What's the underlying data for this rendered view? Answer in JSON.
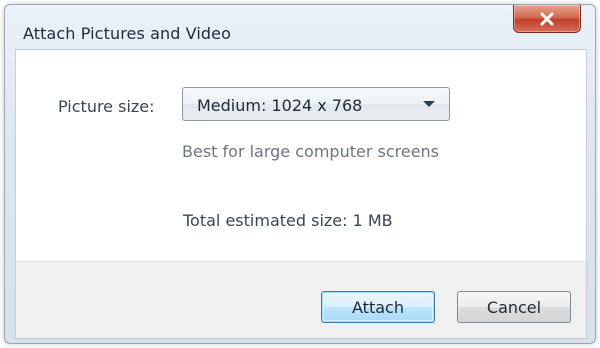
{
  "window": {
    "title": "Attach Pictures and Video"
  },
  "form": {
    "picture_size_label": "Picture size:",
    "picture_size_value": "Medium: 1024 x 768",
    "picture_size_hint": "Best for large computer screens",
    "total_size_text": "Total estimated size: 1 MB"
  },
  "buttons": {
    "attach_label": "Attach",
    "cancel_label": "Cancel"
  },
  "icons": {
    "close": "close-icon",
    "dropdown": "chevron-down-icon"
  },
  "colors": {
    "close_button": "#c1412a",
    "default_button_border": "#3c7fb1"
  }
}
